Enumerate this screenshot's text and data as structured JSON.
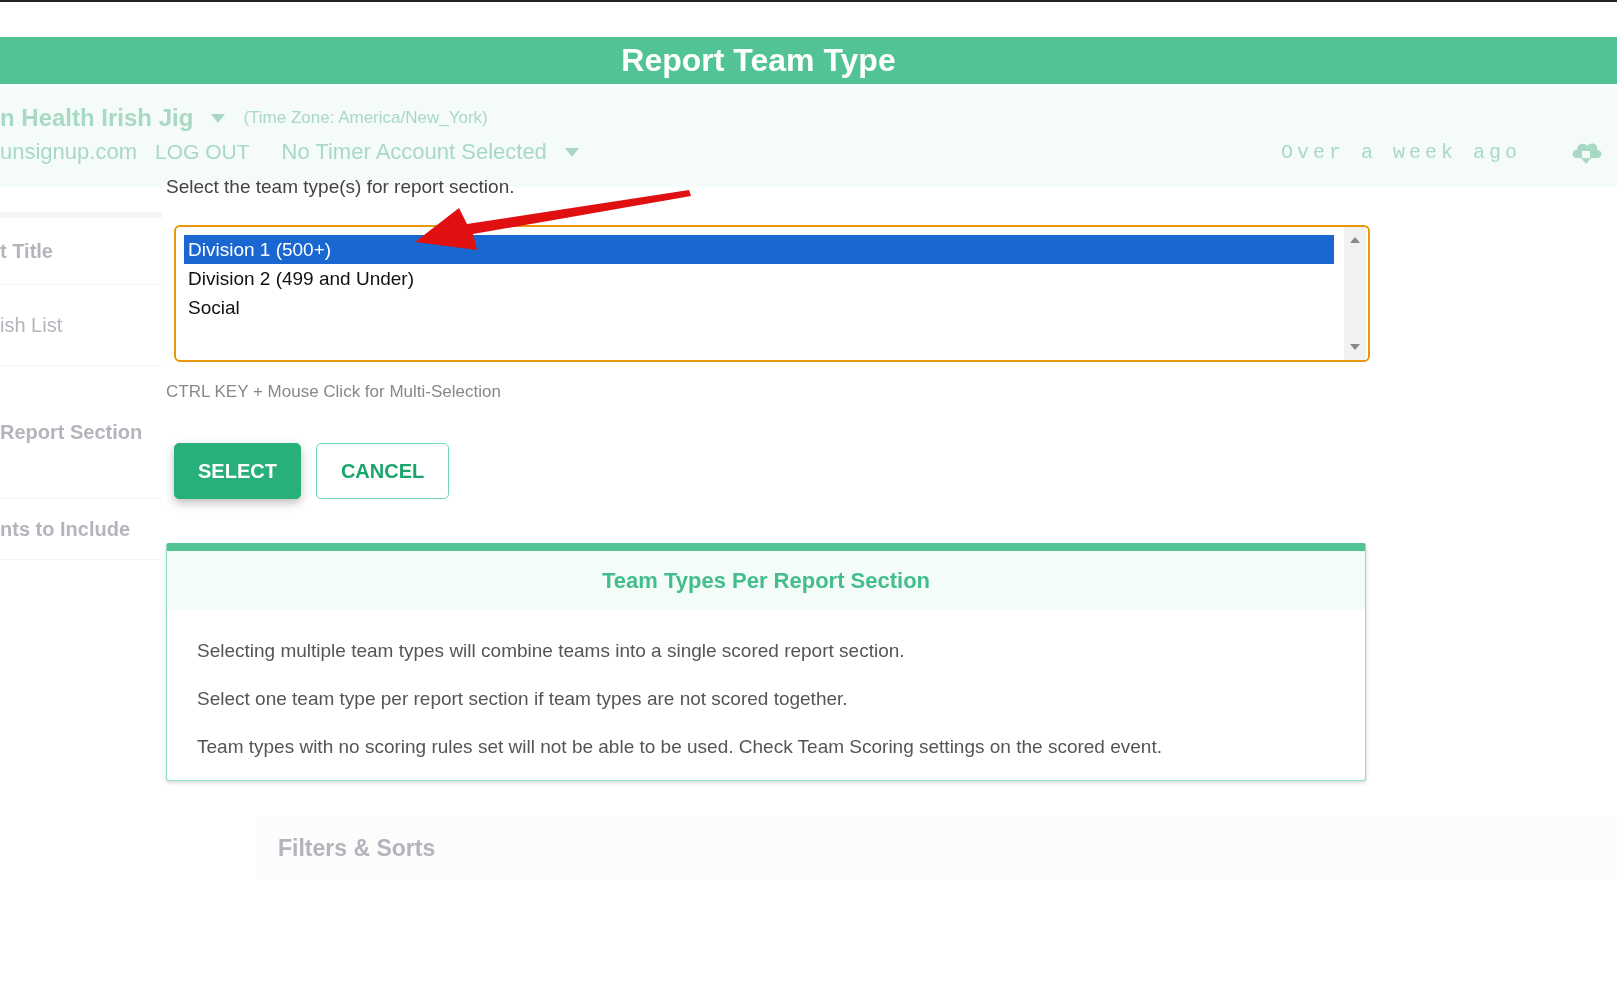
{
  "window": {
    "title": "Report Team Type"
  },
  "background": {
    "header": {
      "event": "n Health Irish Jig",
      "timezone": "(Time Zone: America/New_York)",
      "account": "unsignup.com",
      "logout": "LOG OUT",
      "timer": "No Timer Account Selected",
      "updated": "Over a week ago"
    },
    "sidebar": [
      "t Title",
      "ish List",
      "Report Section",
      "nts to Include"
    ],
    "panel_heading": "Filters & Sorts"
  },
  "dialog": {
    "prompt": "Select the team type(s) for report section.",
    "options": [
      {
        "label": "Division 1 (500+)",
        "selected": true
      },
      {
        "label": "Division 2 (499 and Under)",
        "selected": false
      },
      {
        "label": "Social",
        "selected": false
      }
    ],
    "hint": "CTRL KEY + Mouse Click for Multi-Selection",
    "buttons": [
      {
        "label": "SELECT",
        "kind": "primary"
      },
      {
        "label": "CANCEL",
        "kind": "secondary"
      }
    ],
    "info": {
      "title": "Team Types Per Report Section",
      "paragraphs": [
        "Selecting multiple team types will combine teams into a single scored report section.",
        "Select one team type per report section if team types are not scored together.",
        "Team types with no scoring rules set will not be able to be used. Check Team Scoring settings on the scored event."
      ]
    }
  }
}
